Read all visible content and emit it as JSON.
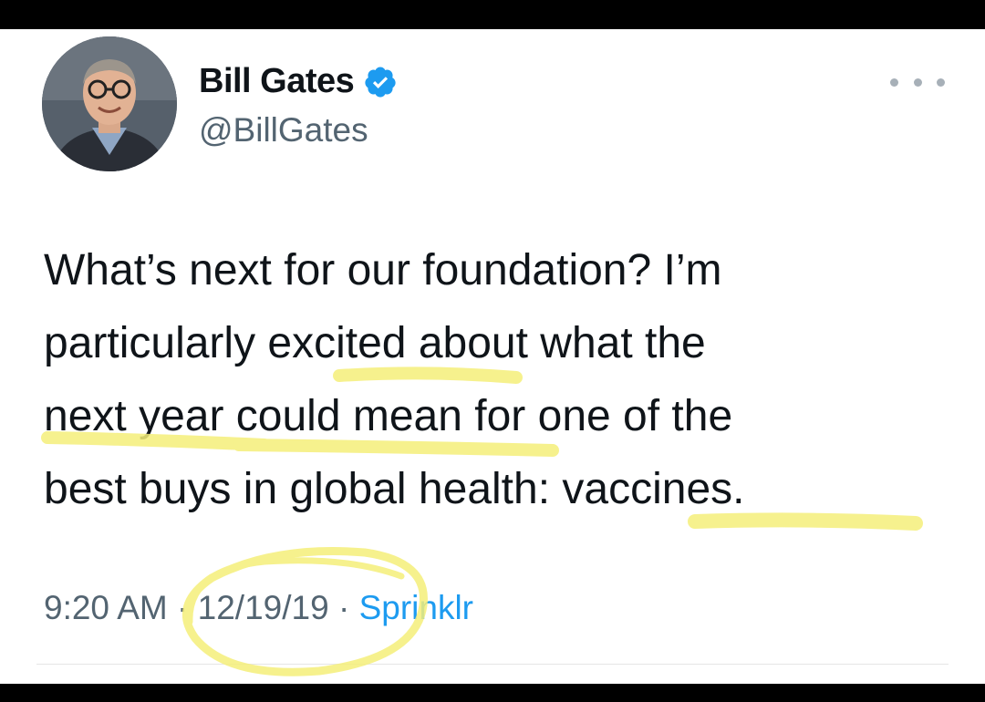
{
  "author": {
    "display_name": "Bill Gates",
    "handle": "@BillGates",
    "verified_icon": "verified-badge-icon",
    "avatar": "profile-photo"
  },
  "tweet": {
    "lines": [
      "What’s next for our foundation? I’m",
      "particularly excited about what the",
      "next year could mean for one of the",
      "best buys in global health: vaccines."
    ]
  },
  "meta": {
    "time": "9:20 AM",
    "separator": " · ",
    "date": "12/19/19",
    "source": "Sprinklr"
  },
  "colors": {
    "verified": "#1d9bf0",
    "source_link": "#1d9bf0",
    "highlighter": "#f5ef7a"
  },
  "more_icon": "more-horizontal-icon"
}
